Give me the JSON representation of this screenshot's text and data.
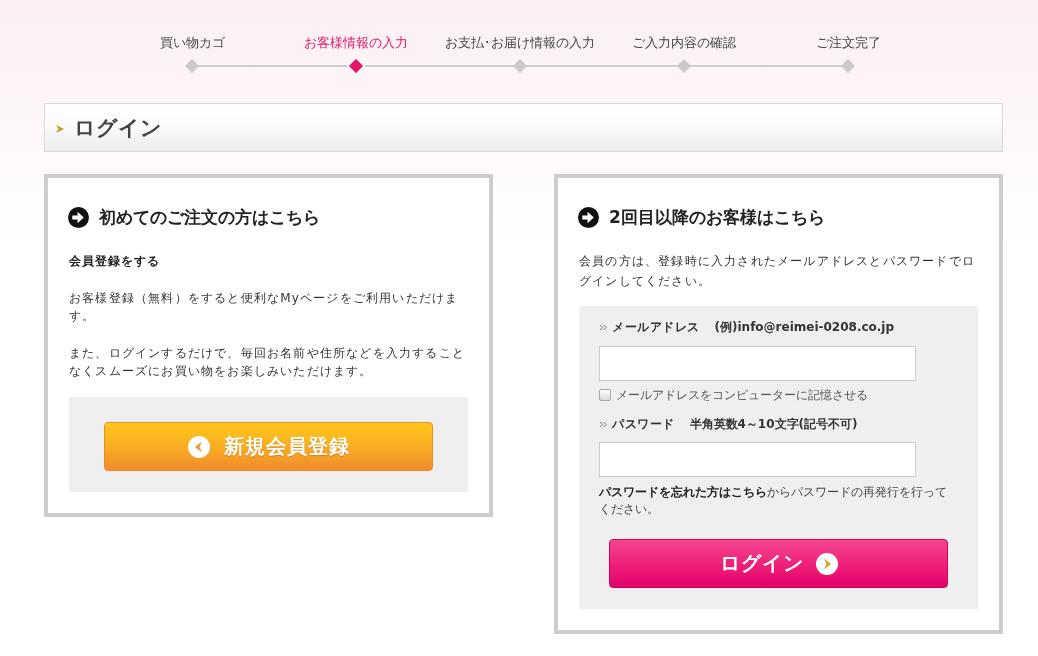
{
  "steps": [
    {
      "label": "買い物カゴ",
      "selected": false
    },
    {
      "label": "お客様情報の入力",
      "selected": true
    },
    {
      "label": "お支払･お届け情報の入力",
      "selected": false
    },
    {
      "label": "ご入力内容の確認",
      "selected": false
    },
    {
      "label": "ご注文完了",
      "selected": false
    }
  ],
  "section_heading": "ログイン",
  "new_customer": {
    "title": "初めてのご注文の方はこちら",
    "subheading": "会員登録をする",
    "paragraphs": [
      "お客様登録（無料）をすると便利なMyページをご利用いただけます。",
      "また、ログインするだけで、毎回お名前や住所などを入力することなくスムーズにお買い物をお楽しみいただけます。"
    ],
    "button": "新規会員登録"
  },
  "returning_customer": {
    "title": "2回目以降のお客様はこちら",
    "description": "会員の方は、登録時に入力されたメールアドレスとパスワードでログインしてください。",
    "email": {
      "label": "メールアドレス",
      "hint": "(例)info@reimei-0208.co.jp"
    },
    "remember": {
      "label": "メールアドレスをコンピューターに記憶させる",
      "checked": false
    },
    "password": {
      "label": "パスワード",
      "hint": "半角英数4～10文字(記号不可)"
    },
    "forgot": {
      "link": "パスワードを忘れた方はこちら",
      "text": "からパスワードの再発行を行ってください。"
    },
    "button": "ログイン"
  }
}
